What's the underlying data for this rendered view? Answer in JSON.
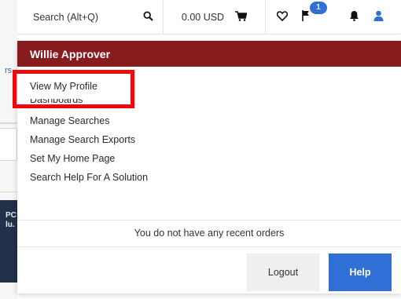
{
  "colors": {
    "header_bg": "#871b1e",
    "accent": "#2f6fd6",
    "highlight": "#ee0a0a"
  },
  "background": {
    "link_fragment": "rs",
    "dark_card_text": "PC\nlu."
  },
  "topbar": {
    "search_label": "Search (Alt+Q)",
    "search_icon": "search-icon",
    "cart_total": "0.00 USD",
    "cart_icon": "cart-icon",
    "favorites_icon": "heart-icon",
    "flag_icon": "flag-icon",
    "notification_badge": "1",
    "bell_icon": "bell-icon",
    "user_icon": "user-icon"
  },
  "dropdown": {
    "user_name": "Willie Approver",
    "items": [
      {
        "label": "View My Profile"
      },
      {
        "label": "Dashboards"
      },
      {
        "label": "Manage Searches"
      },
      {
        "label": "Manage Search Exports"
      },
      {
        "label": "Set My Home Page"
      },
      {
        "label": "Search Help For A Solution"
      }
    ],
    "recent_orders_text": "You do not have any recent orders",
    "logout_label": "Logout",
    "help_label": "Help"
  }
}
